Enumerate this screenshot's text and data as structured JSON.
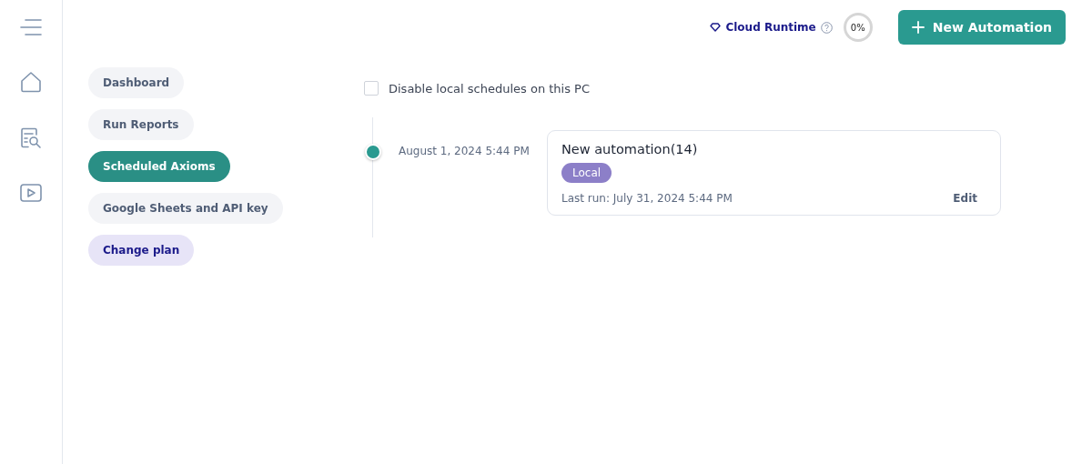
{
  "header": {
    "cloud_runtime": "Cloud Runtime",
    "usage": "0%",
    "new_button": "New Automation"
  },
  "rail": [
    {
      "kind": "menu"
    },
    {
      "kind": "home"
    },
    {
      "kind": "reports"
    },
    {
      "kind": "video"
    }
  ],
  "nav": [
    {
      "label": "Dashboard",
      "selected": false,
      "kind": "page"
    },
    {
      "label": "Run Reports",
      "selected": false,
      "kind": "page"
    },
    {
      "label": "Scheduled Axioms",
      "selected": true,
      "kind": "page"
    },
    {
      "label": "Google Sheets and API key",
      "selected": false,
      "kind": "page"
    },
    {
      "label": "Change plan",
      "selected": false,
      "kind": "plan"
    }
  ],
  "disable_local": {
    "label": "Disable local schedules on this PC",
    "checked": false
  },
  "timeline": [
    {
      "date": "August 1, 2024 5:44 PM",
      "title": "New automation(14)",
      "tag": "Local",
      "color": "#8c7fc8",
      "last_run": "Last run: July 31, 2024 5:44 PM",
      "action": "Edit"
    }
  ]
}
